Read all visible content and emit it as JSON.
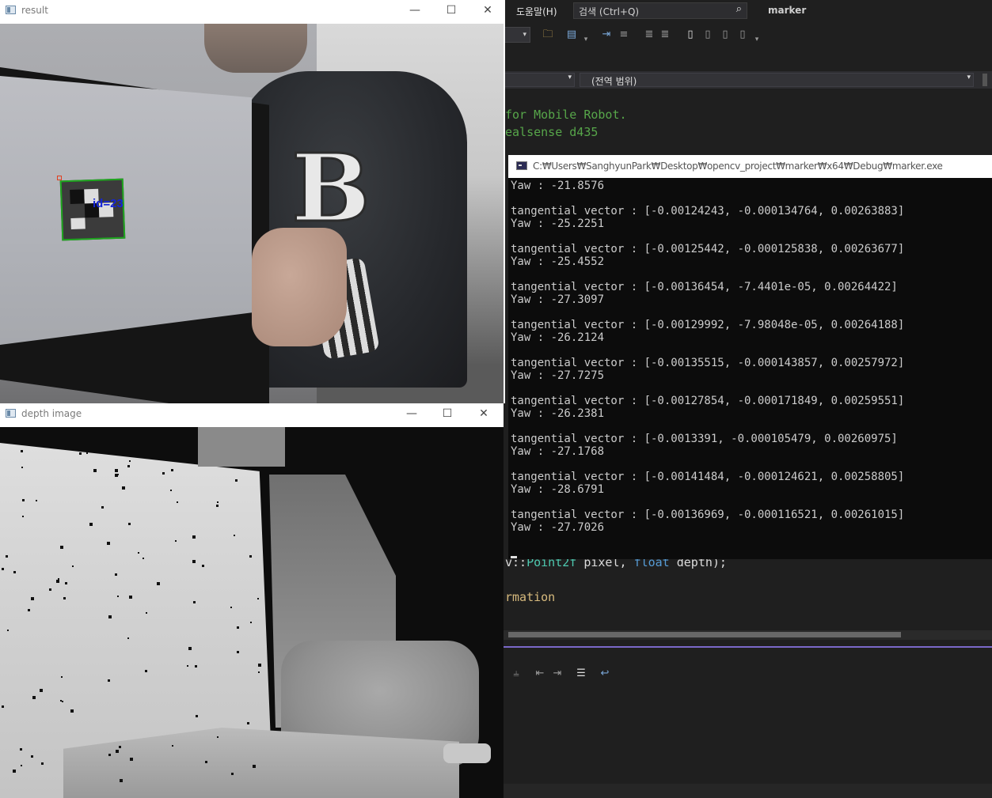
{
  "ide": {
    "menu_help": "도움말(H)",
    "search_placeholder": "검색 (Ctrl+Q)",
    "project_name": "marker",
    "scope_dropdown": "(전역 범위)",
    "code_lines": {
      "line1": "for Mobile Robot.",
      "line2": "ealsense d435",
      "line3_prefix": "v::",
      "line3_type": "Point2f",
      "line3_mid": " pixel, ",
      "line3_kw": "float",
      "line3_end": " depth);",
      "line4": "rmation"
    }
  },
  "console": {
    "title": "C:₩Users₩SanghyunPark₩Desktop₩opencv_project₩marker₩x64₩Debug₩marker.exe",
    "first_line": "Yaw : -21.8576",
    "entries": [
      {
        "vector": "tangential vector : [-0.00124243, -0.000134764, 0.00263883]",
        "yaw": "Yaw : -25.2251"
      },
      {
        "vector": "tangential vector : [-0.00125442, -0.000125838, 0.00263677]",
        "yaw": "Yaw : -25.4552"
      },
      {
        "vector": "tangential vector : [-0.00136454, -7.4401e-05, 0.00264422]",
        "yaw": "Yaw : -27.3097"
      },
      {
        "vector": "tangential vector : [-0.00129992, -7.98048e-05, 0.00264188]",
        "yaw": "Yaw : -26.2124"
      },
      {
        "vector": "tangential vector : [-0.00135515, -0.000143857, 0.00257972]",
        "yaw": "Yaw : -27.7275"
      },
      {
        "vector": "tangential vector : [-0.00127854, -0.000171849, 0.00259551]",
        "yaw": "Yaw : -26.2381"
      },
      {
        "vector": "tangential vector : [-0.0013391, -0.000105479, 0.00260975]",
        "yaw": "Yaw : -27.1768"
      },
      {
        "vector": "tangential vector : [-0.00141484, -0.000124621, 0.00258805]",
        "yaw": "Yaw : -28.6791"
      },
      {
        "vector": "tangential vector : [-0.00136969, -0.000116521, 0.00261015]",
        "yaw": "Yaw : -27.7026"
      }
    ]
  },
  "result_window": {
    "title": "result",
    "marker_label": "id=23"
  },
  "depth_window": {
    "title": "depth image"
  },
  "window_controls": {
    "minimize": "—",
    "maximize": "☐",
    "close": "✕"
  },
  "icons": {
    "search": "search-icon",
    "window_app": "window-app-icon",
    "console_app": "console-app-icon"
  },
  "colors": {
    "ide_bg": "#1f1f1f",
    "console_bg": "#0c0c0c",
    "console_text": "#cccccc",
    "code_green": "#57a64a",
    "marker_border": "#1fa51f",
    "marker_label": "#1424d8",
    "accent_divider": "#7a68c8"
  }
}
